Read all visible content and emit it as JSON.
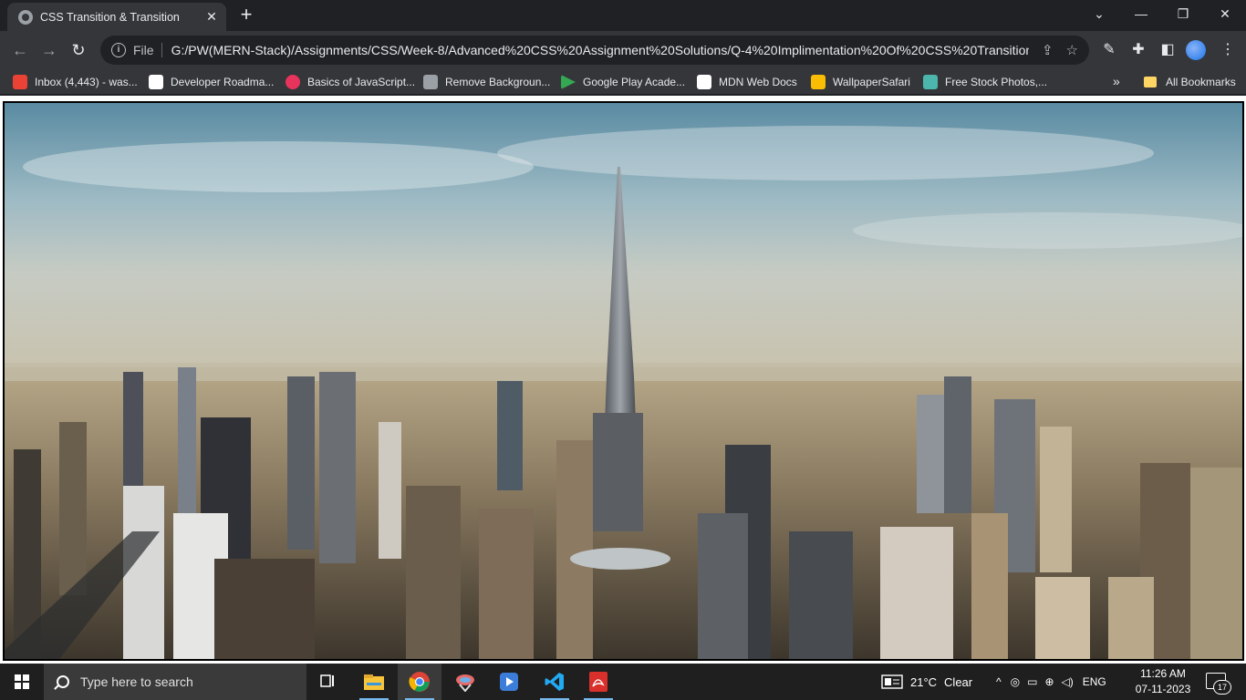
{
  "browser": {
    "tab": {
      "title": "CSS Transition & Transition",
      "close_glyph": "✕"
    },
    "new_tab_glyph": "+",
    "window_controls": {
      "minimize": "—",
      "restore": "❐",
      "close": "✕",
      "tab_search": "⌄"
    },
    "nav": {
      "back": "←",
      "forward": "→",
      "reload": "↻"
    },
    "omnibox": {
      "info_glyph": "i",
      "scheme_label": "File",
      "url": "G:/PW(MERN-Stack)/Assignments/CSS/Week-8/Advanced%20CSS%20Assignment%20Solutions/Q-4%20Implimentation%20Of%20CSS%20Transition%..."
    },
    "toolbar_icons": [
      "share-icon",
      "bookmark-star-icon",
      "eyedropper-icon",
      "extensions-icon",
      "side-panel-icon",
      "profile-avatar",
      "menu-icon"
    ],
    "bookmarks": [
      {
        "label": "Inbox (4,443) - was...",
        "icon": "gmail-icon",
        "color": "#ea4335"
      },
      {
        "label": "Developer Roadma...",
        "icon": "roadmap-icon",
        "color": "#ffffff"
      },
      {
        "label": "Basics of JavaScript...",
        "icon": "js-icon",
        "color": "#e8335d"
      },
      {
        "label": "Remove Backgroun...",
        "icon": "removebg-icon",
        "color": "#9aa0a6"
      },
      {
        "label": "Google Play Acade...",
        "icon": "google-play-icon",
        "color": "#34a853"
      },
      {
        "label": "MDN Web Docs",
        "icon": "mdn-icon",
        "color": "#ffffff"
      },
      {
        "label": "WallpaperSafari",
        "icon": "wallpapersafari-icon",
        "color": "#fbbc04"
      },
      {
        "label": "Free Stock Photos,...",
        "icon": "stock-photos-icon",
        "color": "#4db6ac"
      }
    ],
    "bookmarks_overflow": "»",
    "all_bookmarks_label": "All Bookmarks"
  },
  "page": {
    "hero_image": {
      "subject": "city-skyline-image",
      "sky_color": "#7fa8b9",
      "haze_color": "#c3c5bd",
      "ground_color": "#5e5546"
    }
  },
  "taskbar": {
    "search_placeholder": "Type here to search",
    "apps": [
      "task-view-icon",
      "file-explorer-icon",
      "chrome-icon",
      "snipping-tool-icon",
      "media-player-icon",
      "vscode-icon",
      "pdf-reader-icon"
    ],
    "weather": {
      "temperature": "21°C",
      "condition": "Clear"
    },
    "language": "ENG",
    "time": "11:26 AM",
    "date": "07-11-2023",
    "notification_count": "17"
  }
}
